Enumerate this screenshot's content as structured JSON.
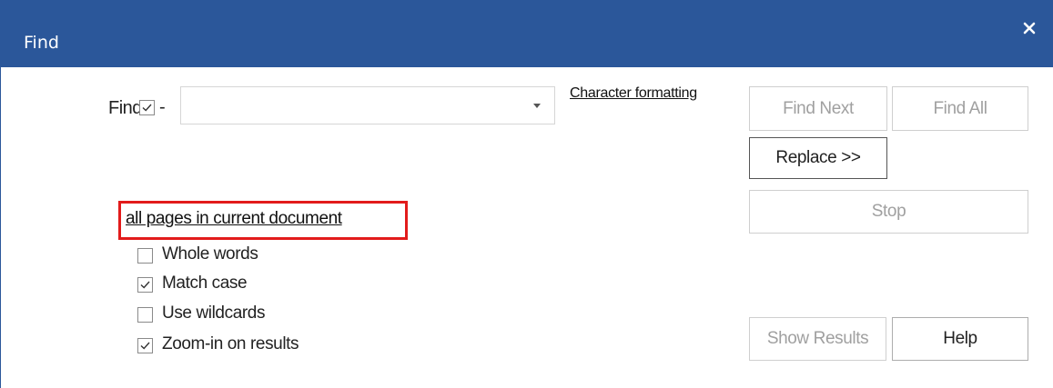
{
  "dialog": {
    "title": "Find",
    "close_glyph": "✕"
  },
  "find": {
    "label": "Find:",
    "checkbox_checked": true,
    "dash": "-",
    "value": "",
    "character_formatting_link": "Character formatting"
  },
  "buttons": {
    "find_next": "Find Next",
    "find_all": "Find All",
    "replace": "Replace >>",
    "stop": "Stop",
    "show_results": "Show Results",
    "help": "Help"
  },
  "scope": {
    "link": "all pages in current document"
  },
  "options": [
    {
      "label": "Whole words",
      "checked": false
    },
    {
      "label": "Match case",
      "checked": true
    },
    {
      "label": "Use wildcards",
      "checked": false
    },
    {
      "label": "Zoom-in on results",
      "checked": true
    }
  ],
  "colors": {
    "titlebar": "#2b579a",
    "highlight_border": "#e21b1b",
    "disabled_text": "#a0a0a0"
  }
}
